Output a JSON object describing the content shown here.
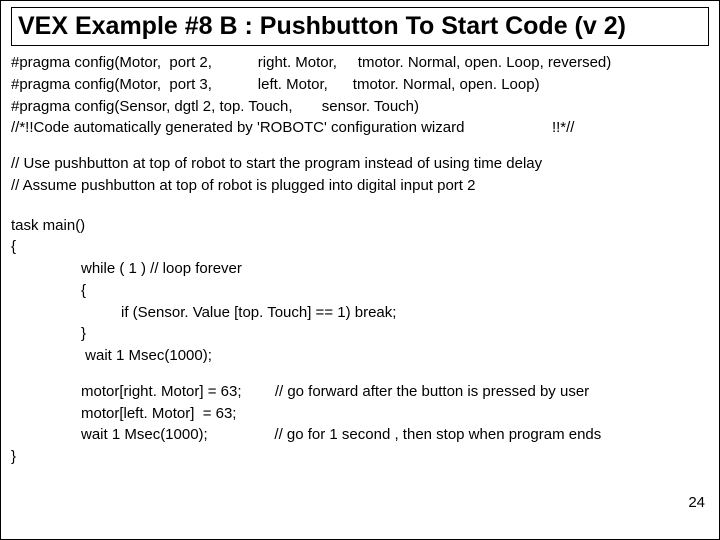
{
  "title": "VEX Example #8 B : Pushbutton To Start Code (v 2)",
  "pragmas": {
    "l1": "#pragma config(Motor,  port 2,           right. Motor,     tmotor. Normal, open. Loop, reversed)",
    "l2": "#pragma config(Motor,  port 3,           left. Motor,      tmotor. Normal, open. Loop)",
    "l3": "#pragma config(Sensor, dgtl 2, top. Touch,       sensor. Touch)",
    "l4": "//*!!Code automatically generated by 'ROBOTC' configuration wizard                     !!*//"
  },
  "comments": {
    "c1": "// Use pushbutton at top of robot to start the program instead of using time delay",
    "c2": "// Assume pushbutton at top of robot is plugged into digital input port 2"
  },
  "code": {
    "task": "task main()",
    "open": "{",
    "while": "while ( 1 ) // loop forever",
    "wopen": "{",
    "ifline": "if (Sensor. Value [top. Touch] == 1) break;",
    "wclose": "}",
    "wait1": " wait 1 Msec(1000);",
    "m1": "motor[right. Motor] = 63;        // go forward after the button is pressed by user",
    "m2": "motor[left. Motor]  = 63;",
    "wait2": "wait 1 Msec(1000);                // go for 1 second , then stop when program ends",
    "close": "}"
  },
  "pagenum": "24"
}
